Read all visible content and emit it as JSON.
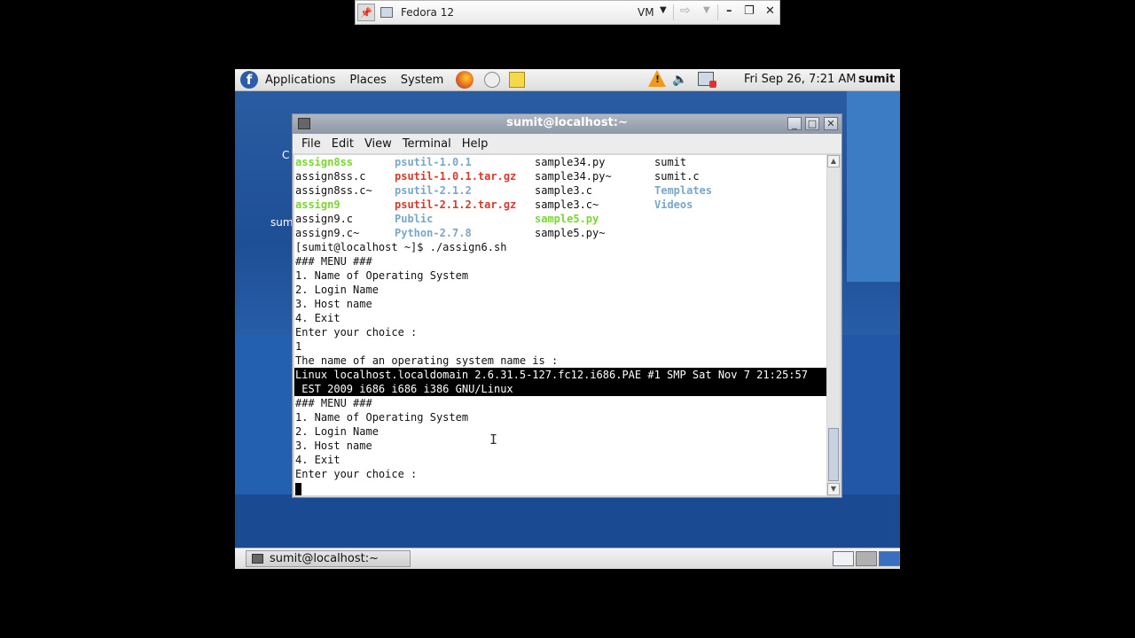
{
  "vm_toolbar": {
    "title": "Fedora 12",
    "vm_menu": "VM",
    "pin_icon": "pin-icon",
    "minimize": "–",
    "restore": "❐",
    "close": "✕"
  },
  "top_panel": {
    "menus": [
      "Applications",
      "Places",
      "System"
    ],
    "clock": "Fri Sep 26,  7:21 AM",
    "user": "sumit"
  },
  "desktop": {
    "fragment1": "C",
    "fragment2": "sum"
  },
  "terminal": {
    "title": "sumit@localhost:~",
    "menus": [
      "File",
      "Edit",
      "View",
      "Terminal",
      "Help"
    ],
    "ls_rows": [
      [
        {
          "t": "assign8ss",
          "c": "green"
        },
        {
          "t": "psutil-1.0.1",
          "c": "blue"
        },
        {
          "t": "sample34.py",
          "c": ""
        },
        {
          "t": "sumit",
          "c": ""
        }
      ],
      [
        {
          "t": "assign8ss.c",
          "c": ""
        },
        {
          "t": "psutil-1.0.1.tar.gz",
          "c": "red"
        },
        {
          "t": "sample34.py~",
          "c": ""
        },
        {
          "t": "sumit.c",
          "c": ""
        }
      ],
      [
        {
          "t": "assign8ss.c~",
          "c": ""
        },
        {
          "t": "psutil-2.1.2",
          "c": "blue"
        },
        {
          "t": "sample3.c",
          "c": ""
        },
        {
          "t": "Templates",
          "c": "blue"
        }
      ],
      [
        {
          "t": "assign9",
          "c": "green"
        },
        {
          "t": "psutil-2.1.2.tar.gz",
          "c": "red"
        },
        {
          "t": "sample3.c~",
          "c": ""
        },
        {
          "t": "Videos",
          "c": "blue"
        }
      ],
      [
        {
          "t": "assign9.c",
          "c": ""
        },
        {
          "t": "Public",
          "c": "blue"
        },
        {
          "t": "sample5.py",
          "c": "green"
        },
        {
          "t": "",
          "c": ""
        }
      ],
      [
        {
          "t": "assign9.c~",
          "c": ""
        },
        {
          "t": "Python-2.7.8",
          "c": "blue"
        },
        {
          "t": "sample5.py~",
          "c": ""
        },
        {
          "t": "",
          "c": ""
        }
      ]
    ],
    "lines_before": [
      "[sumit@localhost ~]$ ./assign6.sh",
      "### MENU ###",
      "1. Name of Operating System",
      "2. Login Name",
      "3. Host name",
      "4. Exit",
      "Enter your choice :",
      "1",
      "The name of an operating system name is :"
    ],
    "highlighted": [
      "Linux localhost.localdomain 2.6.31.5-127.fc12.i686.PAE #1 SMP Sat Nov 7 21:25:57",
      " EST 2009 i686 i686 i386 GNU/Linux"
    ],
    "lines_after": [
      "### MENU ###",
      "1. Name of Operating System",
      "2. Login Name",
      "3. Host name",
      "4. Exit",
      "Enter your choice :"
    ]
  },
  "bottom_panel": {
    "task_label": "sumit@localhost:~"
  }
}
